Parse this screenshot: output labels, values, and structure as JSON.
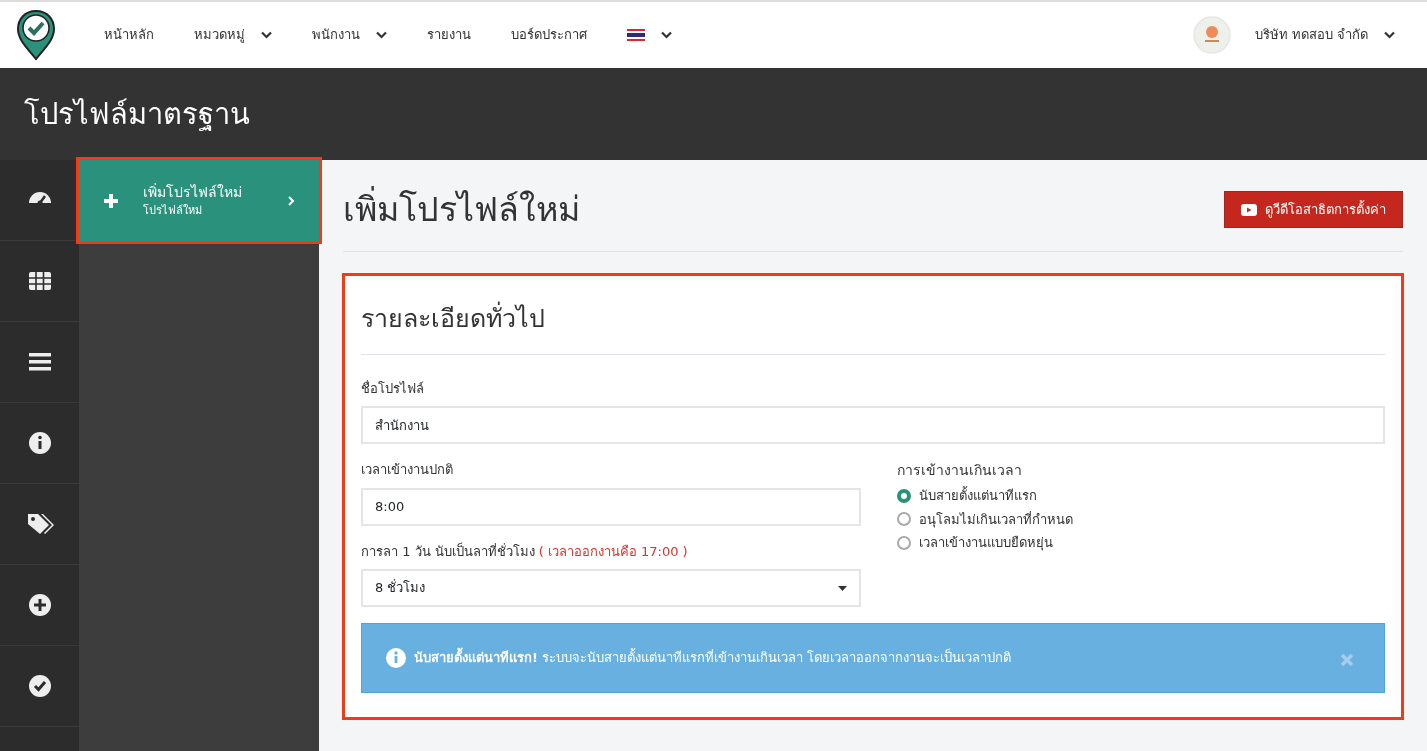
{
  "navbar": {
    "items": [
      {
        "label": "หน้าหลัก",
        "dropdown": false
      },
      {
        "label": "หมวดหมู่",
        "dropdown": true
      },
      {
        "label": "พนักงาน",
        "dropdown": true
      },
      {
        "label": "รายงาน",
        "dropdown": false
      },
      {
        "label": "บอร์ดประกาศ",
        "dropdown": false
      }
    ],
    "language_dropdown": true,
    "company": "บริษัท ทดสอบ จำกัด"
  },
  "page_header": {
    "title": "โปรไฟล์มาตรฐาน"
  },
  "icon_rail": [
    {
      "kind": "dashboard"
    },
    {
      "kind": "table"
    },
    {
      "kind": "list"
    },
    {
      "kind": "info"
    },
    {
      "kind": "tags"
    },
    {
      "kind": "plus"
    },
    {
      "kind": "check"
    }
  ],
  "sidebar": {
    "items": [
      {
        "title": "เพิ่มโปรไฟล์ใหม่",
        "subtitle": "โปรไฟล์ใหม่",
        "selected": true,
        "highlighted": true
      }
    ]
  },
  "main": {
    "title": "เพิ่มโปรไฟล์ใหม่",
    "video_button": "ดูวีดีโอสาธิตการตั้งค่า"
  },
  "card": {
    "title": "รายละเอียดทั่วไป",
    "highlighted": true,
    "profile_name": {
      "label": "ชื่อโปรไฟล์",
      "value": "สำนักงาน"
    },
    "start_time": {
      "label": "เวลาเข้างานปกติ",
      "value": "8:00"
    },
    "leave_hours": {
      "label": "การลา 1 วัน นับเป็นลาที่ชั่วโมง",
      "note": "( เวลาออกงานคือ 17:00 )",
      "value": "8 ชั่วโมง"
    },
    "late_policy": {
      "label": "การเข้างานเกินเวลา",
      "options": [
        {
          "label": "นับสายตั้งแต่นาทีแรก",
          "selected": true
        },
        {
          "label": "อนุโลมไม่เกินเวลาที่กำหนด",
          "selected": false
        },
        {
          "label": "เวลาเข้างานแบบยืดหยุ่น",
          "selected": false
        }
      ]
    },
    "alert": {
      "text": "**นับสายตั้งแต่นาทีแรก!** ระบบจะนับสายตั้งแต่นาทีแรกที่เข้างานเกินเวลา โดยเวลาออกจากงานจะเป็นเวลาปกติ"
    }
  }
}
